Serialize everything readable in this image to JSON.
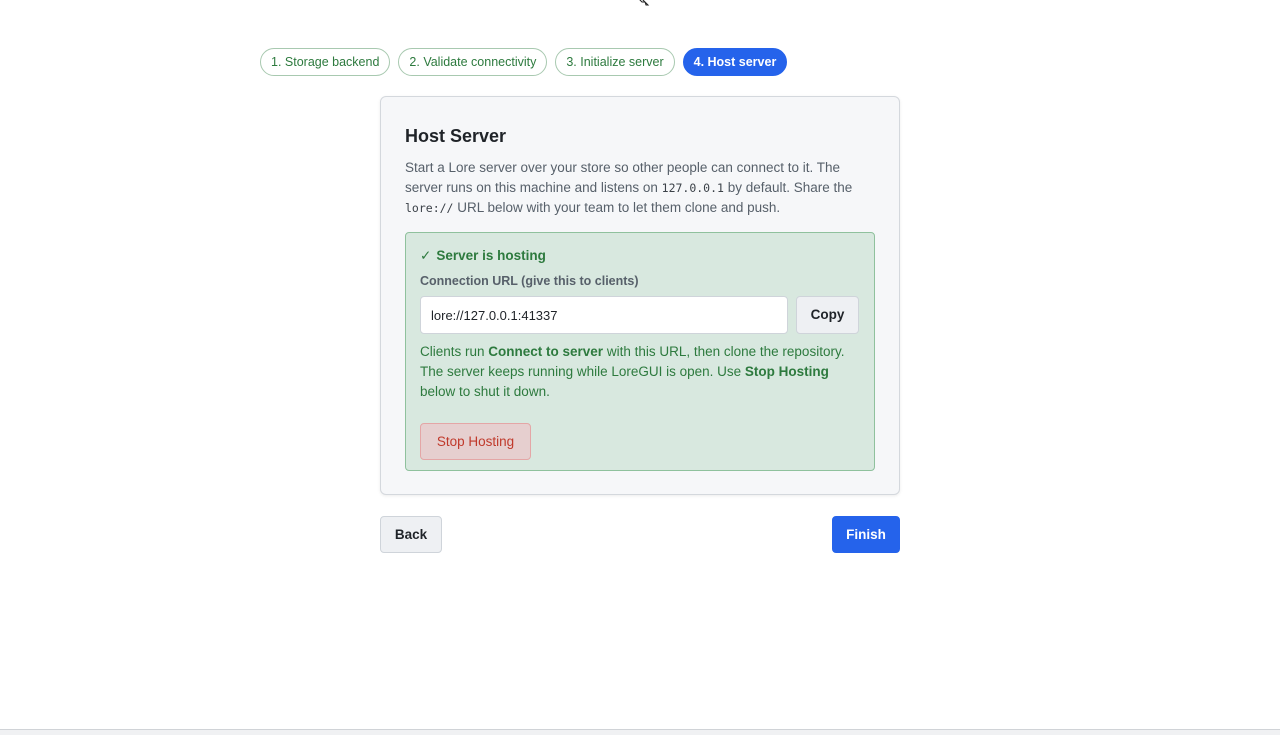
{
  "steps": [
    {
      "label": "1. Storage backend"
    },
    {
      "label": "2. Validate connectivity"
    },
    {
      "label": "3. Initialize server"
    },
    {
      "label": "4. Host server"
    }
  ],
  "card": {
    "title": "Host Server",
    "desc": {
      "p1": "Start a Lore server over your store so other people can connect to it. The server runs on this machine and listens on ",
      "host": "127.0.0.1",
      "p2": " by default. Share the ",
      "scheme": "lore://",
      "p3": " URL below with your team to let them clone and push."
    }
  },
  "hosting": {
    "status_icon": "✓",
    "status_text": "Server is hosting",
    "url_label": "Connection URL (give this to clients)",
    "url_value": "lore://127.0.0.1:41337",
    "copy_label": "Copy",
    "info": {
      "t1": "Clients run ",
      "b1": "Connect to server",
      "t2": " with this URL, then clone the repository. The server keeps running while LoreGUI is open. Use ",
      "b2": "Stop Hosting",
      "t3": " below to shut it down."
    },
    "stop_label": "Stop Hosting"
  },
  "nav": {
    "back_label": "Back",
    "finish_label": "Finish"
  },
  "colors": {
    "accent": "#2563eb",
    "success_text": "#2d7a3e",
    "success_bg": "#d8e8df",
    "danger_text": "#c0392b"
  }
}
